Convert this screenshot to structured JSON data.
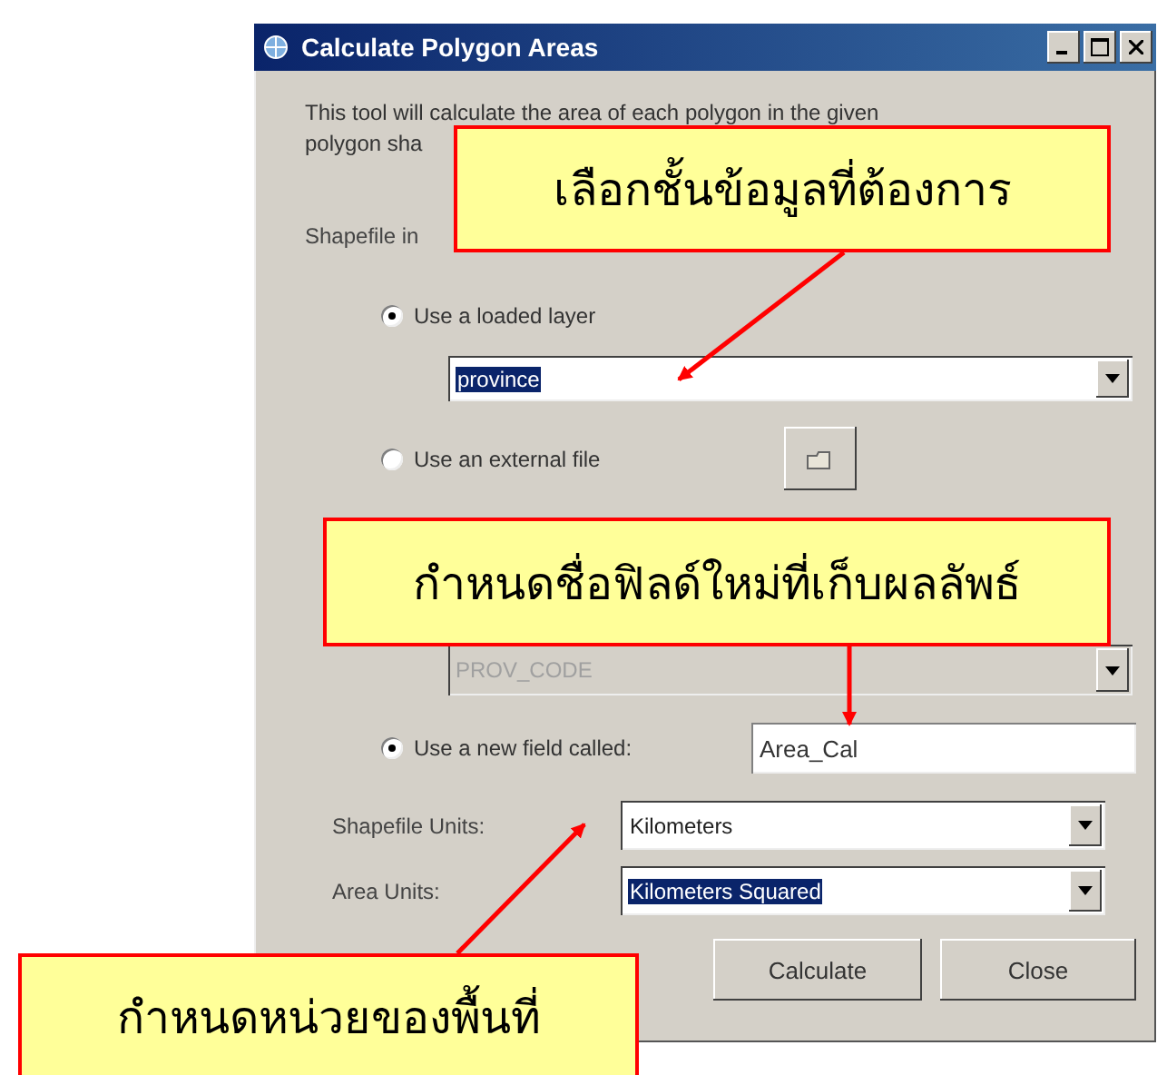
{
  "window": {
    "title": "Calculate Polygon Areas"
  },
  "description": [
    "This tool will calculate the area of each polygon in the given",
    "polygon sha"
  ],
  "section_label": "Shapefile in",
  "layer_options": [
    {
      "label": "Use a loaded layer",
      "selected": true
    },
    {
      "label": "Use an external file",
      "selected": false
    }
  ],
  "layer_combo": {
    "value": "province",
    "highlighted": true
  },
  "field_combo": {
    "value": "PROV_CODE",
    "disabled": true
  },
  "new_field": {
    "label": "Use a new field called:",
    "selected": true,
    "value": "Area_Cal"
  },
  "units": [
    {
      "label": "Shapefile Units:",
      "value": "Kilometers",
      "highlighted": false
    },
    {
      "label": "Area Units:",
      "value": "Kilometers Squared",
      "highlighted": true
    }
  ],
  "buttons": [
    "Calculate",
    "Close"
  ],
  "callouts": [
    "เลือกชั้นข้อมูลที่ต้องการ",
    "กำหนดชื่อฟิลด์ใหม่ที่เก็บผลลัพธ์",
    "กำหนดหน่วยของพื้นที่"
  ]
}
